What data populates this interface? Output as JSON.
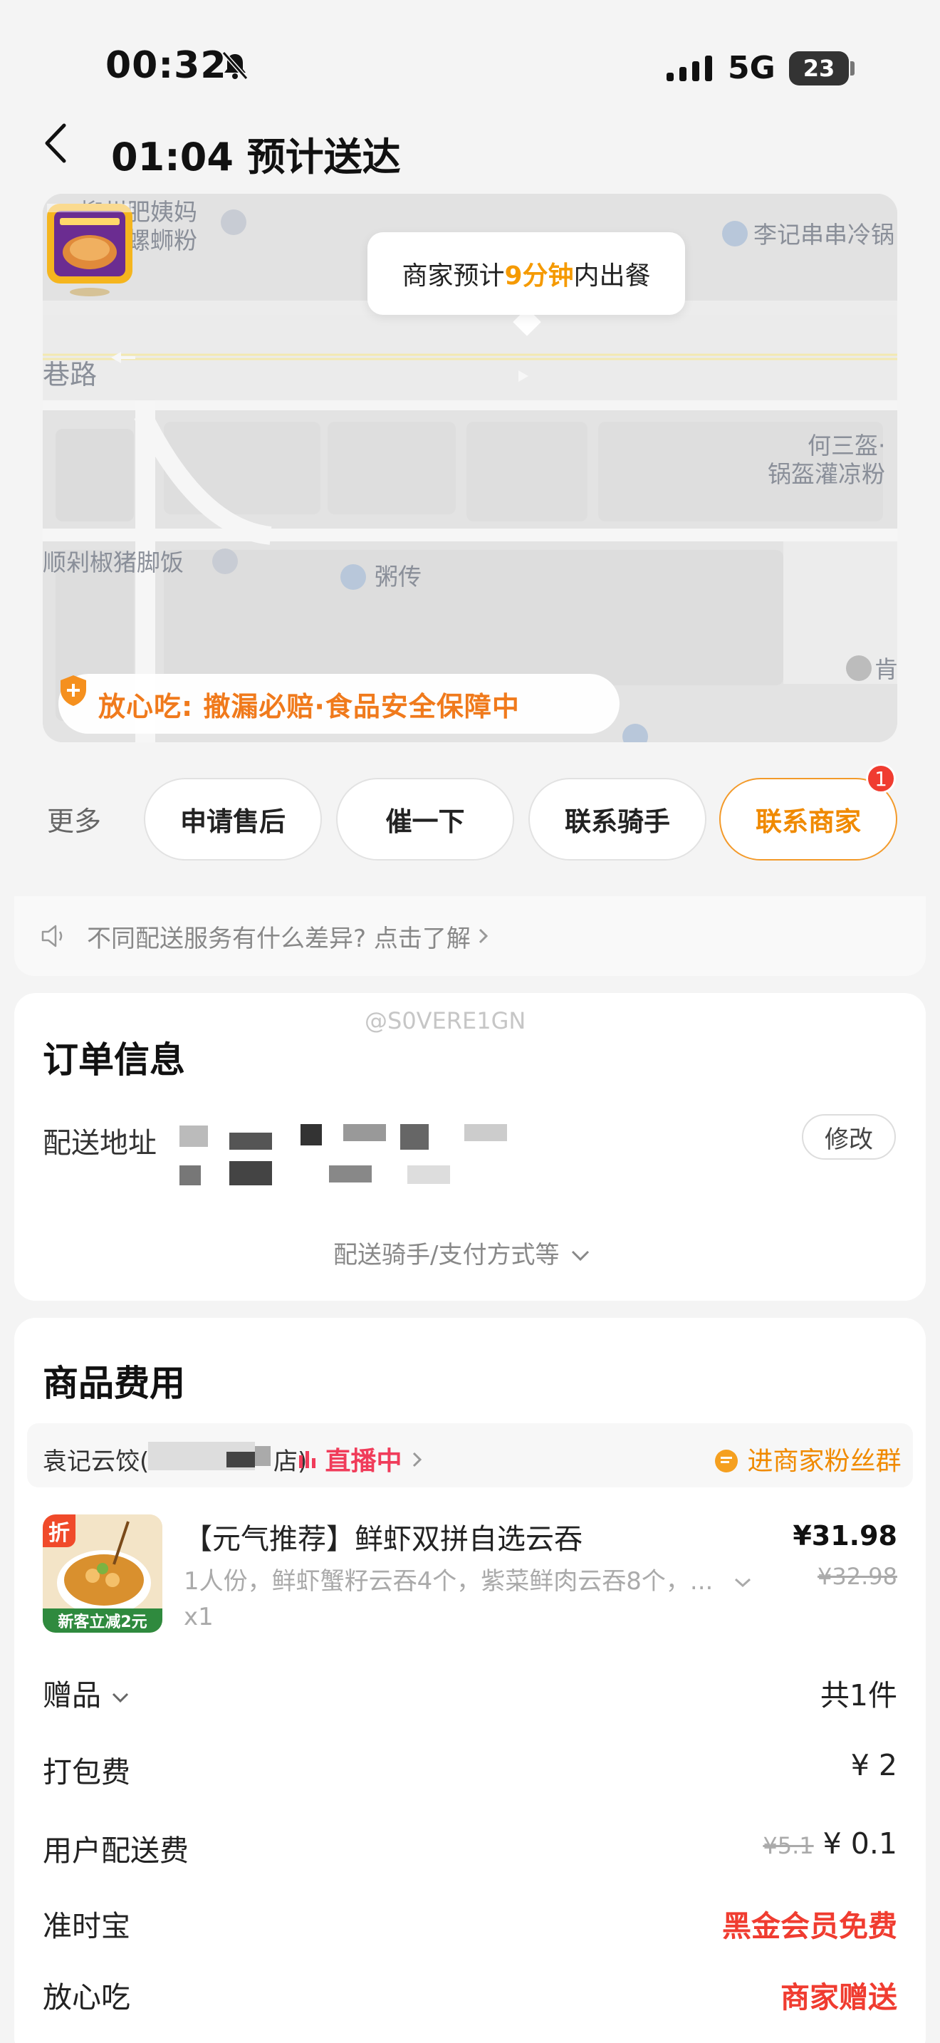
{
  "status_bar": {
    "time": "00:32",
    "network": "5G",
    "battery": "23"
  },
  "header": {
    "title": "01:04 预计送达"
  },
  "map": {
    "bubble_prefix": "商家预计",
    "bubble_highlight": "9分钟",
    "bubble_suffix": "内出餐",
    "labels": {
      "poi1_line1": "柳州肥姨妈",
      "poi1_line2": "大骨螺蛳粉",
      "poi2": "李记串串冷锅",
      "road": "巷路",
      "poi3_line1": "何三盔·",
      "poi3_line2": "锅盔灌凉粉",
      "poi4": "顺剁椒猪脚饭",
      "poi5": "粥传",
      "poi6": "肯"
    },
    "safety_text": "放心吃: 撤漏必赔·食品安全保障中"
  },
  "actions": {
    "more": "更多",
    "after_sale": "申请售后",
    "urge": "催一下",
    "contact_rider": "联系骑手",
    "contact_merchant": "联系商家",
    "merchant_badge": "1"
  },
  "notice": {
    "text": "不同配送服务有什么差异? 点击了解"
  },
  "order_info": {
    "watermark": "@S0VERE1GN",
    "title": "订单信息",
    "address_label": "配送地址",
    "modify": "修改",
    "expand": "配送骑手/支付方式等"
  },
  "goods": {
    "title": "商品费用",
    "shop_prefix": "袁记云饺(",
    "shop_suffix": "店)",
    "live": "直播中",
    "fans_group": "进商家粉丝群",
    "item": {
      "discount_tag": "折",
      "promo_label": "新客立减2元",
      "name": "【元气推荐】鲜虾双拼自选云吞",
      "desc": "1人份，鲜虾蟹籽云吞4个，紫菜鲜肉云吞8个，...",
      "qty": "x1",
      "price": "¥31.98",
      "orig_price": "¥32.98"
    },
    "fees": [
      {
        "label": "赠品",
        "value": "共1件"
      },
      {
        "label": "打包费",
        "value": "¥ 2"
      },
      {
        "label": "用户配送费",
        "orig": "¥5.1",
        "value": "¥ 0.1"
      },
      {
        "label": "准时宝",
        "value": "黑金会员免费"
      },
      {
        "label": "放心吃",
        "value": "商家赠送"
      }
    ]
  }
}
